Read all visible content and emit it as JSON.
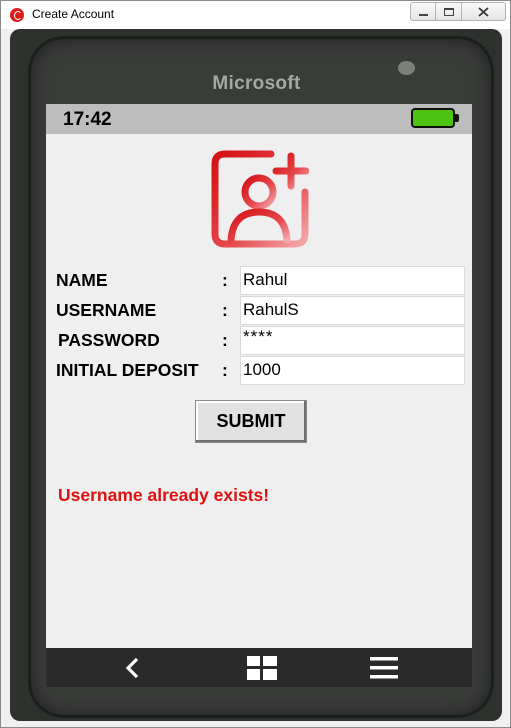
{
  "window": {
    "title": "Create Account",
    "buttons": [
      "minimize",
      "maximize",
      "close"
    ]
  },
  "phone": {
    "brand": "Microsoft",
    "status": {
      "time": "17:42",
      "battery_color": "#4cc411"
    },
    "icon": "add-user-icon",
    "form": {
      "name": {
        "label": "NAME",
        "colon": ":",
        "value": "Rahul"
      },
      "username": {
        "label": "USERNAME",
        "colon": ":",
        "value": "RahulS"
      },
      "password": {
        "label": "PASSWORD",
        "colon": ":",
        "value": "****"
      },
      "deposit": {
        "label": "INITIAL DEPOSIT",
        "colon": ":",
        "value": "1000"
      }
    },
    "submit_label": "SUBMIT",
    "error_message": "Username already exists!",
    "error_color": "#e01010",
    "navbar": [
      "back-icon",
      "start-icon",
      "menu-icon"
    ]
  }
}
